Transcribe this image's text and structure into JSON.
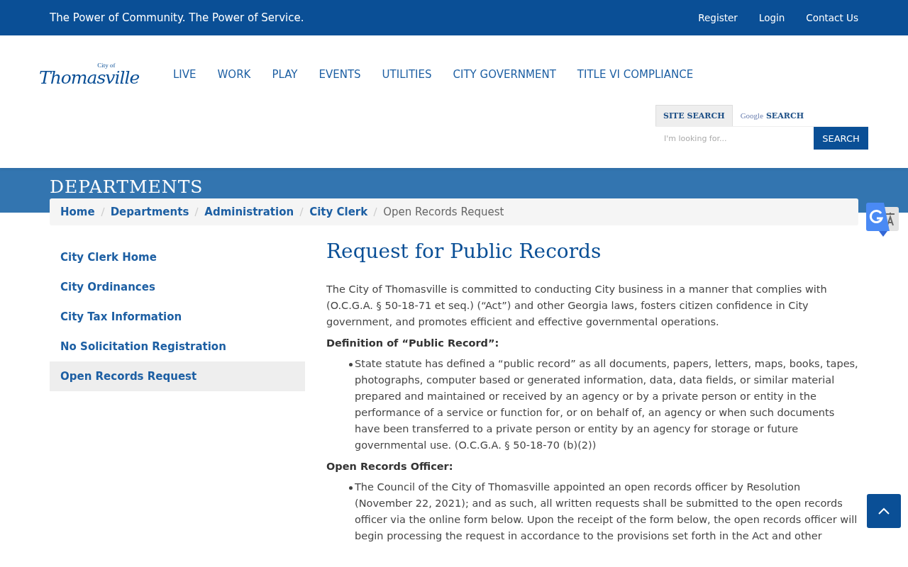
{
  "top_bar": {
    "tagline": "The Power of Community. The Power of Service.",
    "links": [
      "Register",
      "Login",
      "Contact Us"
    ]
  },
  "logo": {
    "small": "City of",
    "name": "Thomasville"
  },
  "nav": [
    "LIVE",
    "WORK",
    "PLAY",
    "EVENTS",
    "UTILITIES",
    "CITY GOVERNMENT",
    "TITLE VI COMPLIANCE"
  ],
  "search": {
    "tabs": [
      {
        "label": "SITE SEARCH",
        "kind": "plain",
        "selected": true
      },
      {
        "label": "SEARCH",
        "kind": "google",
        "brand": "Google",
        "selected": false
      }
    ],
    "placeholder": "I'm looking for...",
    "button": "SEARCH"
  },
  "banner": {
    "title": "DEPARTMENTS"
  },
  "breadcrumb": {
    "links": [
      "Home",
      "Departments",
      "Administration",
      "City Clerk"
    ],
    "current": "Open Records Request"
  },
  "sidebar": {
    "items": [
      {
        "label": "City Clerk Home",
        "selected": false
      },
      {
        "label": "City Ordinances",
        "selected": false
      },
      {
        "label": "City Tax Information",
        "selected": false
      },
      {
        "label": "No Solicitation Registration",
        "selected": false
      },
      {
        "label": "Open Records Request",
        "selected": true
      }
    ]
  },
  "content": {
    "title": "Request for Public Records",
    "blocks": [
      {
        "kind": "paragraph",
        "text": "The City of Thomasville is committed to conducting City business in a manner that complies with (O.C.G.A. § 50-18-71 et seq.) (“Act”) and other Georgia laws, fosters citizen confidence in City government, and promotes efficient and effective governmental operations."
      },
      {
        "kind": "heading",
        "text": "Definition of “Public Record”:"
      },
      {
        "kind": "bullet",
        "text": "State statute has defined a “public record” as all documents, papers, letters, maps, books, tapes, photographs, computer based or generated information, data, data fields, or similar material prepared and maintained or received by an agency or by a private person or entity in the performance of a service or function for, or on behalf of, an agency or when such documents have been transferred to a private person or entity by an agency for storage or future governmental use. (O.C.G.A. § 50-18-70 (b)(2))"
      },
      {
        "kind": "heading",
        "text": "Open Records Officer:"
      },
      {
        "kind": "bullet",
        "text": "The Council of the City of Thomasville appointed an open records officer by Resolution (November 22, 2021); and as such, all written requests shall be submitted to the open records officer via the online form below. Upon the receipt of the form below, the open records officer will begin processing the request in accordance to the provisions set forth in the Act and other"
      }
    ]
  }
}
